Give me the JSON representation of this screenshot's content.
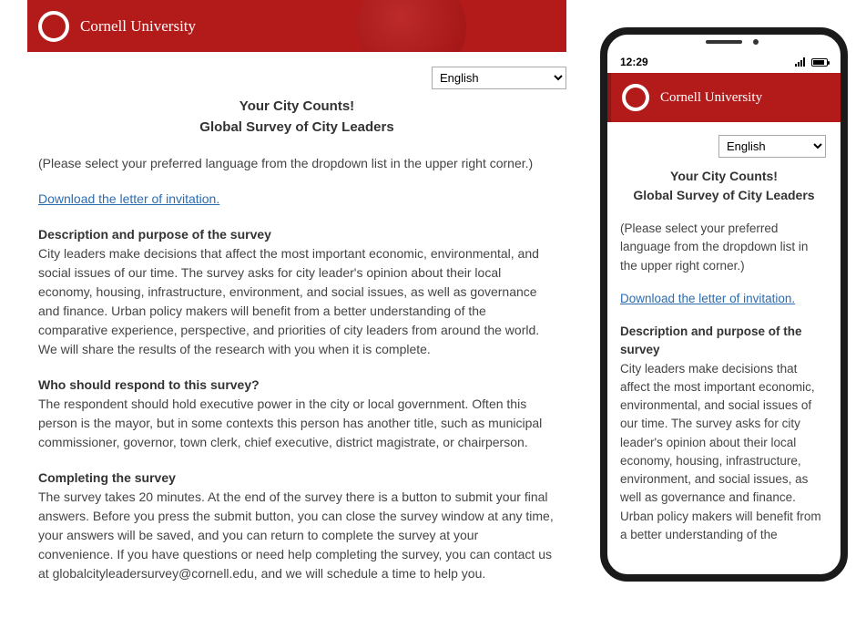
{
  "brand": "Cornell University",
  "language_selected": "English",
  "survey": {
    "title1": "Your City Counts!",
    "title2": "Global Survey of City Leaders",
    "lang_hint": "(Please select your preferred language from the dropdown list in the upper right corner.)",
    "download_link": "Download the letter of invitation.",
    "desc_heading": "Description and purpose of the survey",
    "desc_body": "City leaders make decisions that affect the most important economic, environmental, and social issues of our time. The survey asks for city leader's opinion about their local economy, housing, infrastructure, environment, and social issues, as well as governance and finance. Urban policy makers will benefit from a better understanding of the comparative experience, perspective, and priorities of city leaders from around the world. We will share the results of the research with you when it is complete.",
    "who_heading": "Who should respond to this survey?",
    "who_body": "The respondent should hold executive power in the city or local government. Often this person is the mayor, but in some contexts this person has another title, such as municipal commissioner, governor, town clerk, chief executive, district magistrate, or chairperson.",
    "complete_heading": "Completing the survey",
    "complete_body": "The survey takes 20 minutes. At the end of the survey there is a button to submit your final answers. Before you press the submit button, you can close the survey window at any time, your answers will be saved, and you can return to complete the survey at your convenience. If you have questions or need help completing the survey, you can contact us at globalcityleadersurvey@cornell.edu, and we will schedule a time to help you."
  },
  "mobile": {
    "time": "12:29",
    "desc_body_truncated": "City leaders make decisions that affect the most important economic, environmental, and social issues of our time. The survey asks for city leader's opinion about their local economy, housing, infrastructure, environment, and social issues, as well as governance and finance. Urban policy makers will benefit from a better understanding of the"
  }
}
